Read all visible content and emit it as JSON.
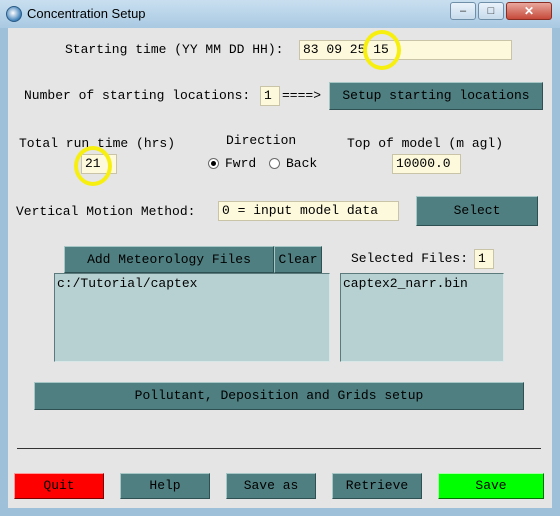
{
  "window": {
    "title": "Concentration Setup",
    "minimize": "–",
    "maximize": "□",
    "close": "✕"
  },
  "start": {
    "label": "Starting time (YY MM DD HH):",
    "value": "83 09 25 15"
  },
  "locations": {
    "label": "Number of starting locations:",
    "value": "1",
    "arrow": "====>",
    "setup_button": "Setup starting locations"
  },
  "run": {
    "label": "Total run time (hrs)",
    "value": "21"
  },
  "direction": {
    "label": "Direction",
    "forward": "Fwrd",
    "back": "Back",
    "selected": "Fwrd"
  },
  "top_model": {
    "label": "Top of model (m agl)",
    "value": "10000.0"
  },
  "vertical": {
    "label": "Vertical Motion Method:",
    "value": "0 = input model data",
    "select_button": "Select"
  },
  "meteorology": {
    "add_button": "Add Meteorology Files",
    "clear_button": "Clear",
    "selected_label": "Selected Files:",
    "selected_count": "1",
    "directory": "c:/Tutorial/captex",
    "files": [
      "captex2_narr.bin"
    ]
  },
  "pollutant_button": "Pollutant, Deposition and Grids setup",
  "footer": {
    "quit": "Quit",
    "help": "Help",
    "save_as": "Save as",
    "retrieve": "Retrieve",
    "save": "Save"
  },
  "colors": {
    "quit_bg": "#ff0000",
    "save_bg": "#00ff00",
    "button_bg": "#4f7f81",
    "field_bg": "#fdf9dc",
    "highlight_ring": "#f7ef10"
  }
}
